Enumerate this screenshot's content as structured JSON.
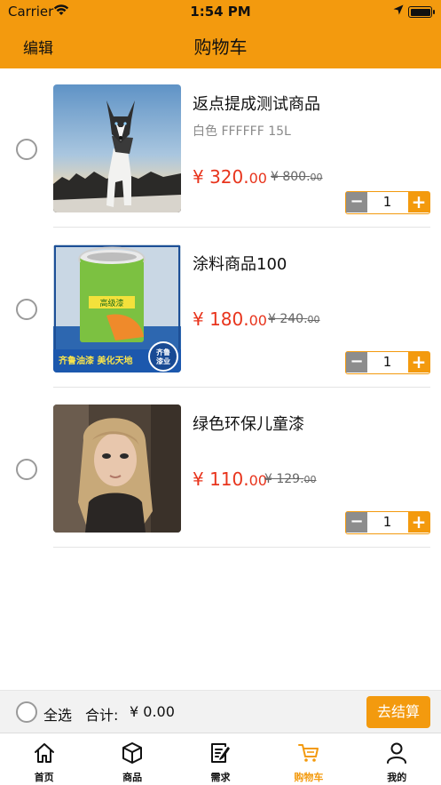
{
  "status_bar": {
    "carrier": "Carrier",
    "time": "1:54 PM"
  },
  "nav": {
    "edit_label": "编辑",
    "title": "购物车"
  },
  "items": [
    {
      "name": "返点提成测试商品",
      "spec": "白色 FFFFFF 15L",
      "price_int": "¥ 320.",
      "price_dec": "00",
      "orig_int": "¥ 800.",
      "orig_dec": "00",
      "qty": "1",
      "image": "husky-dog-photo"
    },
    {
      "name": "涂料商品100",
      "spec": "",
      "price_int": "¥ 180.",
      "price_dec": "00",
      "orig_int": "¥ 240.",
      "orig_dec": "00",
      "qty": "1",
      "image": "paint-bucket-photo",
      "image_texts": {
        "banner_left": "齐鲁油漆 美化天地",
        "badge_top": "齐鲁",
        "badge_bottom": "漆业",
        "bucket_label": "高级漆"
      }
    },
    {
      "name": "绿色环保儿童漆",
      "spec": "",
      "price_int": "¥ 110.",
      "price_dec": "00",
      "orig_int": "¥ 129.",
      "orig_dec": "00",
      "qty": "1",
      "image": "portrait-photo"
    }
  ],
  "checkout": {
    "select_all_label": "全选",
    "total_label": "合计:",
    "total_value": "¥ 0.00",
    "checkout_label": "去结算"
  },
  "tabs": [
    {
      "label": "首页",
      "icon": "home-icon"
    },
    {
      "label": "商品",
      "icon": "box-icon"
    },
    {
      "label": "需求",
      "icon": "document-edit-icon"
    },
    {
      "label": "购物车",
      "icon": "cart-icon",
      "active": true
    },
    {
      "label": "我的",
      "icon": "user-icon"
    }
  ],
  "colors": {
    "accent": "#F39A0E",
    "price": "#E8341C",
    "muted": "#8a8a8a"
  }
}
